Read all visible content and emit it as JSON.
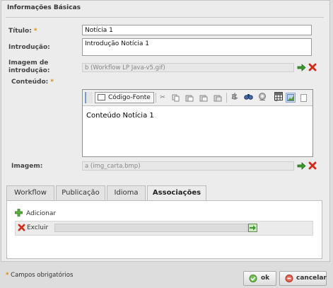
{
  "section": {
    "title": "Informações Básicas"
  },
  "fields": {
    "titulo": {
      "label": "Título:",
      "required": "*",
      "value": "Notícia 1"
    },
    "introducao": {
      "label": "Introdução:",
      "value": "Introdução Notícia 1"
    },
    "imagem_introducao": {
      "label_line1": "Imagem de",
      "label_line2": "introdução:",
      "value": "b (Workflow LP Java-v5.gif)"
    },
    "conteudo": {
      "label": "Conteúdo:",
      "required": "*",
      "value": "Conteúdo Notícia 1"
    },
    "imagem": {
      "label": "Imagem:",
      "value": "a (img_carta.bmp)"
    }
  },
  "editor": {
    "source_button": "Código-Fonte",
    "icons": [
      "cut-icon",
      "copy-icon",
      "paste-icon",
      "paste-text-icon",
      "paste-word-icon",
      "bold-icon",
      "italic-icon",
      "underline-icon",
      "remove-format-icon",
      "image-icon",
      "page-icon",
      "anchor-icon",
      "find-icon",
      "replace-icon",
      "table-icon"
    ],
    "bold": "B",
    "italic": "I",
    "underline": "U"
  },
  "tabs": [
    {
      "label": "Workflow"
    },
    {
      "label": "Publicação"
    },
    {
      "label": "Idioma"
    },
    {
      "label": "Associações",
      "active": true
    }
  ],
  "associations": {
    "add_label": "Adicionar",
    "remove_label": "Excluir",
    "value": ""
  },
  "footer": {
    "required_note_marker": "*",
    "required_note": "Campos obrigatórios",
    "ok_label": "ok",
    "cancel_label": "cancelar"
  },
  "colors": {
    "required": "#e08a00",
    "green_arrow": "#3a9a2a",
    "red_x": "#d42a1a",
    "panel": "#ececec"
  }
}
